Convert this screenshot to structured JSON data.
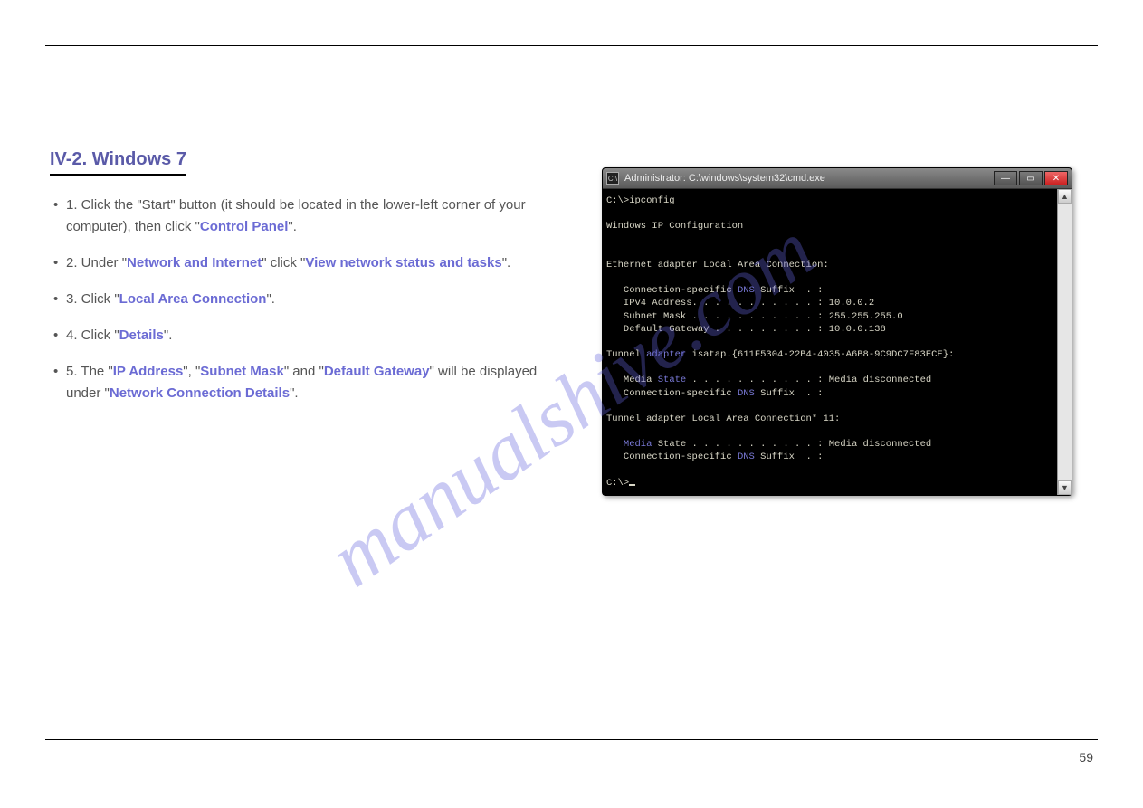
{
  "section": {
    "title": "IV-2. Windows 7"
  },
  "body": {
    "p1_a": "1.   Click the \"Start\" button (it should be located in the lower-left corner of your computer), then click \"",
    "p1_b": "Control Panel",
    "p1_c": "\".",
    "p2_a": "2.   Under \"",
    "p2_b": "Network and Internet",
    "p2_c": "\" click \"",
    "p2_d": "View network status and tasks",
    "p2_e": "\".",
    "p3_a": "3.   Click \"",
    "p3_b": "Local Area Connection",
    "p3_c": "\".",
    "p4_a": "4.   Click \"",
    "p4_b": "Details",
    "p4_c": "\".",
    "p5_a": "5.   The \"",
    "p5_b": "IP Address",
    "p5_c": "\", \"",
    "p5_d": "Subnet Mask",
    "p5_e": "\" and \"",
    "p5_f": "Default Gateway",
    "p5_g": "\" will be displayed under \"",
    "p5_h": "Network Connection Details",
    "p5_i": "\"."
  },
  "cmd": {
    "title": "Administrator: C:\\windows\\system32\\cmd.exe",
    "line1": "C:\\>ipconfig",
    "line2": "Windows IP Configuration",
    "line3": "Ethernet adapter Local Area Connection:",
    "line4a": "   Connection-specific ",
    "line4b": "DNS",
    "line4c": " Suffix  . :",
    "line5": "   IPv4 Address. . . . . . . . . . . : 10.0.0.2",
    "line6": "   Subnet Mask . . . . . . . . . . . : 255.255.255.0",
    "line7": "   Default Gateway . . . . . . . . . : 10.0.0.138",
    "line8a": "Tunnel ",
    "line8b": "adapter",
    "line8c": " isatap.{611F5304-22B4-4035-A6B8-9C9DC7F83ECE}:",
    "line9a": "   Media ",
    "line9b": "State",
    "line9c": " . . . . . . . . . . . : Media disconnected",
    "line10a": "   Connection-specific ",
    "line10b": "DNS",
    "line10c": " Suffix  . :",
    "line11": "Tunnel adapter Local Area Connection* 11:",
    "line12a": "   ",
    "line12b": "Media",
    "line12c": " State . . . . . . . . . . . : Media disconnected",
    "line13a": "   Connection-specific ",
    "line13b": "DNS",
    "line13c": " Suffix  . :",
    "line14": "C:\\>"
  },
  "watermark": "manualshive.com",
  "page_number": "59",
  "icons": {
    "app": "C:\\",
    "min": "—",
    "max": "▭",
    "close": "✕",
    "up": "▲",
    "down": "▼"
  }
}
